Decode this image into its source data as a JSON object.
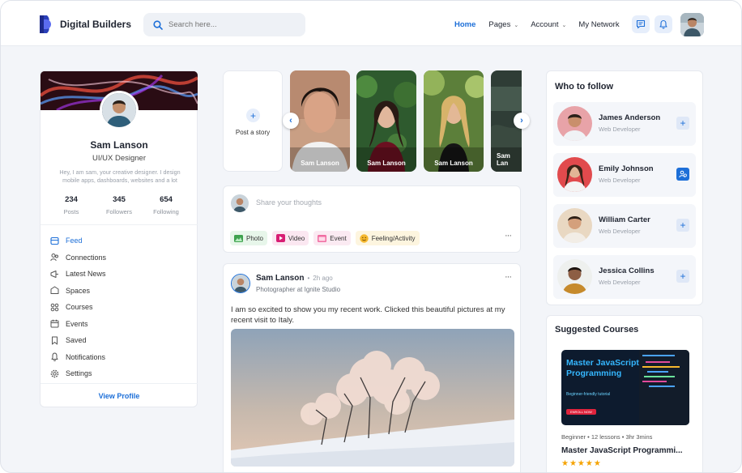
{
  "header": {
    "brand": "Digital Builders",
    "search_placeholder": "Search here...",
    "nav": [
      {
        "label": "Home",
        "active": true
      },
      {
        "label": "Pages",
        "dropdown": true
      },
      {
        "label": "Account",
        "dropdown": true
      },
      {
        "label": "My Network"
      }
    ],
    "icons": [
      "chat-icon",
      "bell-icon"
    ],
    "accent": "#1d6fd8"
  },
  "profile": {
    "name": "Sam Lanson",
    "role": "UI/UX Designer",
    "bio": "Hey, I am sam, your creative designer. I design mobile apps, dashboards, websites and a lot",
    "stats": [
      {
        "value": "234",
        "label": "Posts"
      },
      {
        "value": "345",
        "label": "Followers"
      },
      {
        "value": "654",
        "label": "Following"
      }
    ],
    "menu": [
      {
        "label": "Feed",
        "icon": "feed-icon",
        "active": true
      },
      {
        "label": "Connections",
        "icon": "connections-icon"
      },
      {
        "label": "Latest News",
        "icon": "news-icon"
      },
      {
        "label": "Spaces",
        "icon": "spaces-icon"
      },
      {
        "label": "Courses",
        "icon": "courses-icon"
      },
      {
        "label": "Events",
        "icon": "calendar-icon"
      },
      {
        "label": "Saved",
        "icon": "bookmark-icon"
      },
      {
        "label": "Notifications",
        "icon": "bell-icon"
      },
      {
        "label": "Settings",
        "icon": "gear-icon"
      }
    ],
    "view_profile": "View Profile"
  },
  "stories": {
    "post_label": "Post a story",
    "items": [
      {
        "name": "Sam Lanson"
      },
      {
        "name": "Sam Lanson"
      },
      {
        "name": "Sam Lanson"
      },
      {
        "name": "Sam Lan"
      }
    ]
  },
  "composer": {
    "placeholder": "Share your thoughts",
    "actions": [
      {
        "label": "Photo",
        "icon": "photo-icon",
        "color": "#e7f6ea"
      },
      {
        "label": "Video",
        "icon": "video-icon",
        "color": "#fbe7f1"
      },
      {
        "label": "Event",
        "icon": "event-icon",
        "color": "#fbeaf2"
      },
      {
        "label": "Feeling/Activity",
        "icon": "smile-icon",
        "color": "#fdf5df"
      }
    ],
    "more": "···"
  },
  "post": {
    "author": "Sam Lanson",
    "time": "2h ago",
    "separator": "•",
    "subtitle": "Photographer at Ignite Studio",
    "text": "I am so excited to show you my recent work. Clicked this beautiful pictures at my recent visit to Italy.",
    "more": "···"
  },
  "who_to_follow": {
    "title": "Who to follow",
    "people": [
      {
        "name": "James Anderson",
        "role": "Web Developer",
        "followed": false
      },
      {
        "name": "Emily Johnson",
        "role": "Web Developer",
        "followed": true
      },
      {
        "name": "William Carter",
        "role": "Web Developer",
        "followed": false
      },
      {
        "name": "Jessica Collins",
        "role": "Web Developer",
        "followed": false
      }
    ]
  },
  "courses": {
    "title": "Suggested Courses",
    "card_title": "Master JavaScript Programming",
    "card_sub": "Beginner-friendly tutorial",
    "card_button": "ENROLL NOW",
    "meta": "Beginner • 12 lessons • 3hr 3mins",
    "name": "Master JavaScript Programmi...",
    "rating_stars": 5,
    "stars": "★★★★★"
  }
}
